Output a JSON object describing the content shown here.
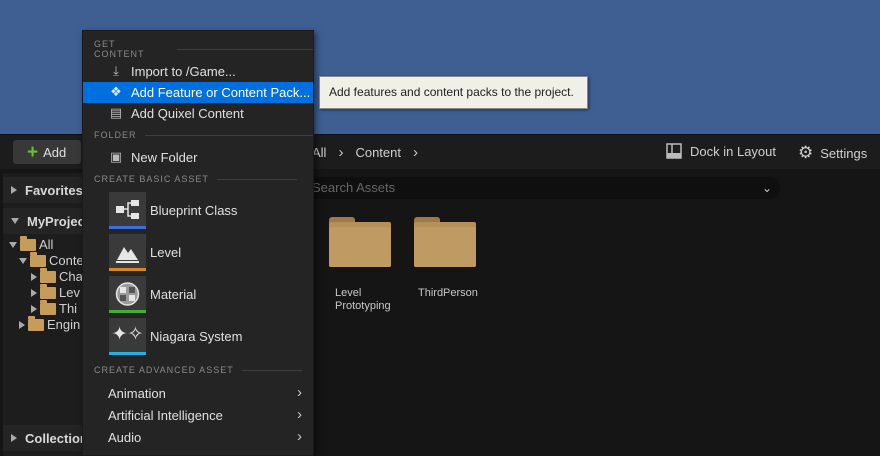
{
  "toolbar": {
    "add_label": "Add",
    "breadcrumb": [
      "All",
      "Content"
    ],
    "dock_label": "Dock in Layout",
    "settings_label": "Settings"
  },
  "search": {
    "placeholder": "Search Assets"
  },
  "left_panel": {
    "favorites": "Favorites",
    "project": "MyProjec",
    "tree": [
      "All",
      "Conte",
      "Cha",
      "Lev",
      "Thi",
      "Engin"
    ],
    "collections": "Collection"
  },
  "assets": [
    {
      "label": "Level Prototyping"
    },
    {
      "label": "ThirdPerson"
    }
  ],
  "menu": {
    "sections": {
      "get_content": "GET CONTENT",
      "folder": "FOLDER",
      "create_basic": "CREATE BASIC ASSET",
      "create_advanced": "CREATE ADVANCED ASSET"
    },
    "get_content_items": [
      "Import to /Game...",
      "Add Feature or Content Pack...",
      "Add Quixel Content"
    ],
    "folder_items": [
      "New Folder"
    ],
    "basic_assets": [
      {
        "label": "Blueprint Class",
        "color": "#3b6ee0",
        "icon": "blueprint-icon"
      },
      {
        "label": "Level",
        "color": "#e0861c",
        "icon": "level-icon"
      },
      {
        "label": "Material",
        "color": "#3fb22f",
        "icon": "material-icon"
      },
      {
        "label": "Niagara System",
        "color": "#2aaee0",
        "icon": "niagara-icon"
      }
    ],
    "advanced_items": [
      "Animation",
      "Artificial Intelligence",
      "Audio"
    ]
  },
  "tooltip": "Add features and content packs to the project."
}
